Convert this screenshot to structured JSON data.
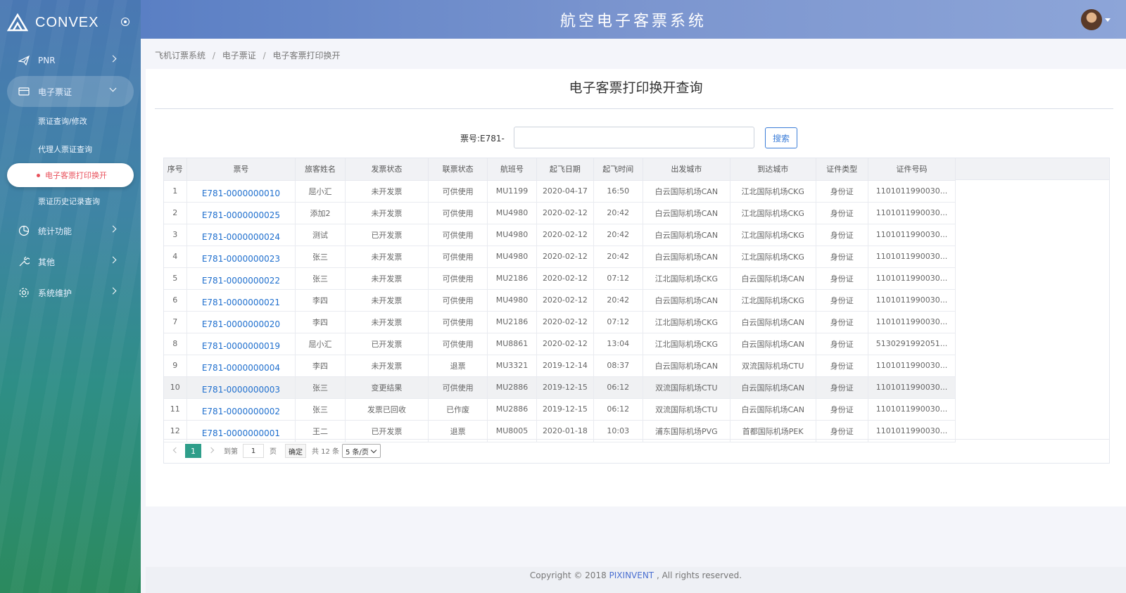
{
  "brand": {
    "name": "CONVEX"
  },
  "header": {
    "title": "航空电子客票系统"
  },
  "sidebar": {
    "items": [
      {
        "label": "PNR",
        "icon": "plane-icon"
      },
      {
        "label": "电子票证",
        "icon": "card-icon",
        "open": true,
        "children": [
          {
            "label": "票证查询/修改"
          },
          {
            "label": "代理人票证查询"
          },
          {
            "label": "电子客票打印换开",
            "active": true
          },
          {
            "label": "票证历史记录查询"
          }
        ]
      },
      {
        "label": "统计功能",
        "icon": "chart-icon"
      },
      {
        "label": "其他",
        "icon": "wrench-icon"
      },
      {
        "label": "系统维护",
        "icon": "gear-icon"
      }
    ]
  },
  "breadcrumb": [
    "飞机订票系统",
    "电子票证",
    "电子客票打印换开"
  ],
  "breadcrumb_sep": "/",
  "page": {
    "title": "电子客票打印换开查询"
  },
  "search": {
    "label": "票号:E781-",
    "value": "",
    "button": "搜索"
  },
  "table": {
    "columns": [
      "序号",
      "票号",
      "旅客姓名",
      "发票状态",
      "联票状态",
      "航班号",
      "起飞日期",
      "起飞时间",
      "出发城市",
      "到达城市",
      "证件类型",
      "证件号码"
    ],
    "rows": [
      [
        "1",
        "E781-0000000010",
        "屈小汇",
        "未开发票",
        "可供使用",
        "MU1199",
        "2020-04-17",
        "16:50",
        "白云国际机场CAN",
        "江北国际机场CKG",
        "身份证",
        "1101011990030..."
      ],
      [
        "2",
        "E781-0000000025",
        "添加2",
        "未开发票",
        "可供使用",
        "MU4980",
        "2020-02-12",
        "20:42",
        "白云国际机场CAN",
        "江北国际机场CKG",
        "身份证",
        "1101011990030..."
      ],
      [
        "3",
        "E781-0000000024",
        "测试",
        "已开发票",
        "可供使用",
        "MU4980",
        "2020-02-12",
        "20:42",
        "白云国际机场CAN",
        "江北国际机场CKG",
        "身份证",
        "1101011990030..."
      ],
      [
        "4",
        "E781-0000000023",
        "张三",
        "未开发票",
        "可供使用",
        "MU4980",
        "2020-02-12",
        "20:42",
        "白云国际机场CAN",
        "江北国际机场CKG",
        "身份证",
        "1101011990030..."
      ],
      [
        "5",
        "E781-0000000022",
        "张三",
        "未开发票",
        "可供使用",
        "MU2186",
        "2020-02-12",
        "07:12",
        "江北国际机场CKG",
        "白云国际机场CAN",
        "身份证",
        "1101011990030..."
      ],
      [
        "6",
        "E781-0000000021",
        "李四",
        "未开发票",
        "可供使用",
        "MU4980",
        "2020-02-12",
        "20:42",
        "白云国际机场CAN",
        "江北国际机场CKG",
        "身份证",
        "1101011990030..."
      ],
      [
        "7",
        "E781-0000000020",
        "李四",
        "未开发票",
        "可供使用",
        "MU2186",
        "2020-02-12",
        "07:12",
        "江北国际机场CKG",
        "白云国际机场CAN",
        "身份证",
        "1101011990030..."
      ],
      [
        "8",
        "E781-0000000019",
        "屈小汇",
        "已开发票",
        "可供使用",
        "MU8861",
        "2020-02-12",
        "13:04",
        "江北国际机场CKG",
        "白云国际机场CAN",
        "身份证",
        "5130291992051..."
      ],
      [
        "9",
        "E781-0000000004",
        "李四",
        "未开发票",
        "退票",
        "MU3321",
        "2019-12-14",
        "08:37",
        "白云国际机场CAN",
        "双流国际机场CTU",
        "身份证",
        "1101011990030..."
      ],
      [
        "10",
        "E781-0000000003",
        "张三",
        "变更结果",
        "可供使用",
        "MU2886",
        "2019-12-15",
        "06:12",
        "双流国际机场CTU",
        "白云国际机场CAN",
        "身份证",
        "1101011990030..."
      ],
      [
        "11",
        "E781-0000000002",
        "张三",
        "发票已回收",
        "已作废",
        "MU2886",
        "2019-12-15",
        "06:12",
        "双流国际机场CTU",
        "白云国际机场CAN",
        "身份证",
        "1101011990030..."
      ],
      [
        "12",
        "E781-0000000001",
        "王二",
        "已开发票",
        "退票",
        "MU8005",
        "2020-01-18",
        "10:03",
        "浦东国际机场PVG",
        "首都国际机场PEK",
        "身份证",
        "1101011990030..."
      ]
    ],
    "highlight_row": 10
  },
  "pager": {
    "current": "1",
    "goto_label": "到第",
    "goto_value": "1",
    "page_unit": "页",
    "confirm": "确定",
    "total": "共 12 条",
    "page_size": "5 条/页"
  },
  "footer": {
    "prefix": "Copyright © 2018 ",
    "brand": "PIXINVENT",
    "suffix": " , All rights reserved."
  }
}
